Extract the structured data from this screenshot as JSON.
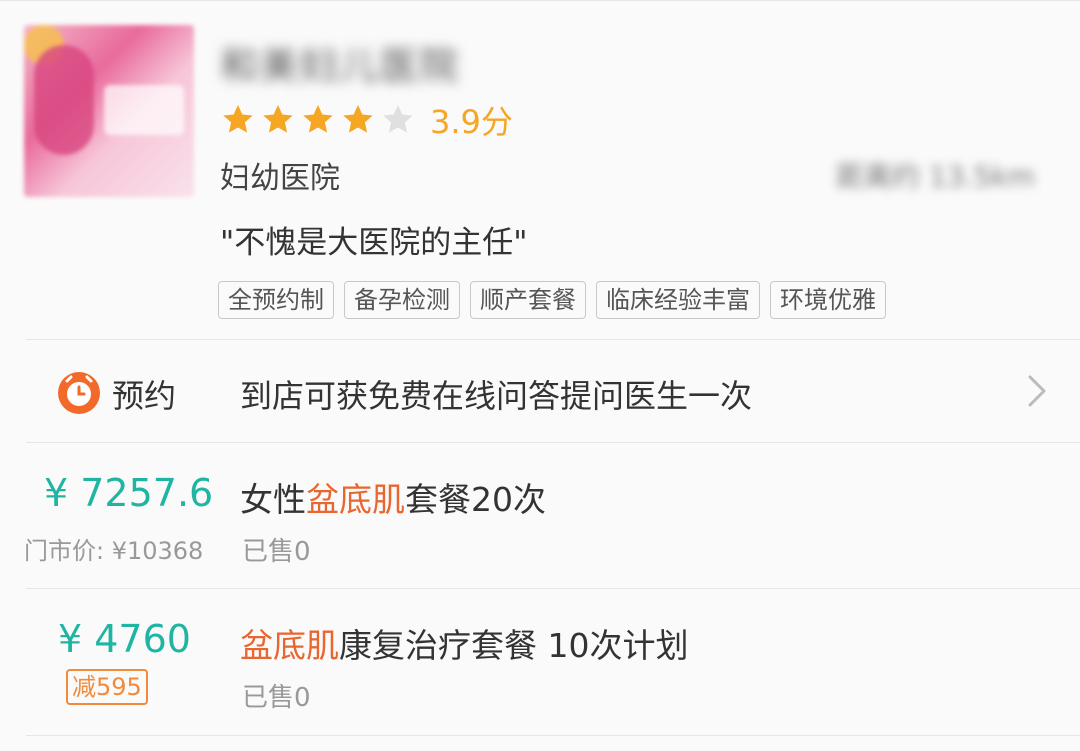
{
  "shop": {
    "name": "和美妇儿医院",
    "rating": {
      "stars_filled": 4,
      "stars_total": 5,
      "score_text": "3.9分",
      "star_color": "#f5a623",
      "star_empty_color": "#e0e0e0"
    },
    "category": "妇幼医院",
    "distance": "距离约 13.5km",
    "quote": "\"不愧是大医院的主任\"",
    "tags": [
      "全预约制",
      "备孕检测",
      "顺产套餐",
      "临床经验丰富",
      "环境优雅"
    ]
  },
  "booking": {
    "icon": "alarm-clock-icon",
    "icon_color": "#f26a2a",
    "label": "预约",
    "text": "到店可获免费在线问答提问医生一次"
  },
  "deals": [
    {
      "price": "¥ 7257.6",
      "original_price": "门市价: ¥10368",
      "title_pre": "女性",
      "title_highlight": "盆底肌",
      "title_post": "套餐20次",
      "sold": "已售0"
    },
    {
      "price": "¥ 4760",
      "discount": "减595",
      "title_pre": "",
      "title_highlight": "盆底肌",
      "title_post": "康复治疗套餐 10次计划",
      "sold": "已售0"
    }
  ],
  "colors": {
    "price": "#1fb5a2",
    "highlight": "#e8662f",
    "accent_orange": "#f28a3c"
  }
}
